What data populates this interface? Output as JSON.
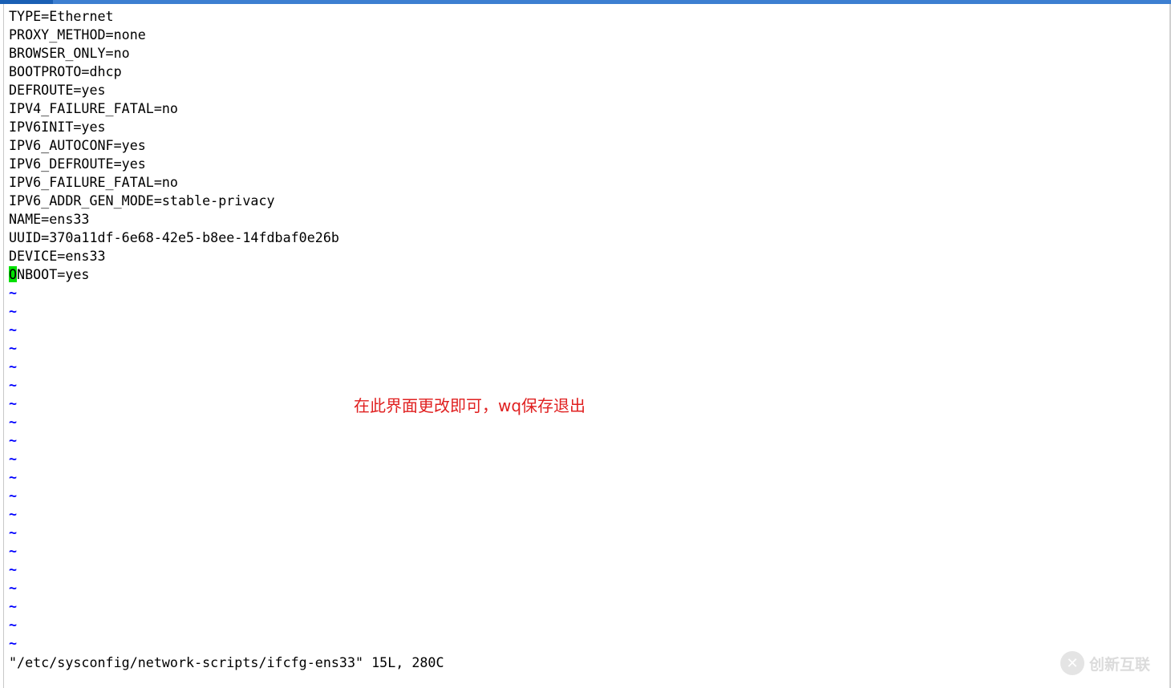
{
  "editor": {
    "lines": [
      "TYPE=Ethernet",
      "PROXY_METHOD=none",
      "BROWSER_ONLY=no",
      "BOOTPROTO=dhcp",
      "DEFROUTE=yes",
      "IPV4_FAILURE_FATAL=no",
      "IPV6INIT=yes",
      "IPV6_AUTOCONF=yes",
      "IPV6_DEFROUTE=yes",
      "IPV6_FAILURE_FATAL=no",
      "IPV6_ADDR_GEN_MODE=stable-privacy",
      "NAME=ens33",
      "UUID=370a11df-6e68-42e5-b8ee-14fdbaf0e26b",
      "DEVICE=ens33"
    ],
    "cursor_line": {
      "cursor_char": "O",
      "rest": "NBOOT=yes"
    },
    "empty_marker": "~",
    "empty_lines": 20,
    "tilde_color": "#0000ff",
    "cursor_color": "#00e000"
  },
  "status_line": "\"/etc/sysconfig/network-scripts/ifcfg-ens33\" 15L, 280C",
  "annotation": {
    "text": "在此界面更改即可，wq保存退出",
    "color": "#e02020"
  },
  "watermark": {
    "icon": "swirl-logo-icon",
    "text": "创新互联"
  }
}
